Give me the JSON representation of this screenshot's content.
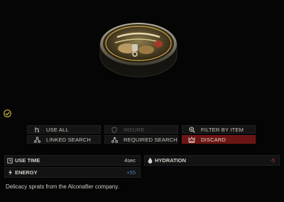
{
  "item": {
    "name": "Canned sprats",
    "label_text": "ШПРОТЫ В МАСЛЕ",
    "description": "Delicacy sprats from the Alconafter company."
  },
  "actions": [
    {
      "label": "USE ALL",
      "icon": "use-all-icon",
      "state": "normal"
    },
    {
      "label": "INSURE",
      "icon": "insure-shield-icon",
      "state": "disabled"
    },
    {
      "label": "FILTER BY ITEM",
      "icon": "magnifier-icon",
      "state": "normal"
    },
    {
      "label": "LINKED SEARCH",
      "icon": "link-search-icon",
      "state": "normal"
    },
    {
      "label": "REQUIRED SEARCH",
      "icon": "required-search-icon",
      "state": "normal"
    },
    {
      "label": "DISCARD",
      "icon": "crown-discard-icon",
      "state": "danger"
    }
  ],
  "stats": {
    "use_time": {
      "label": "USE TIME",
      "value": "4sec",
      "icon": "clock-icon"
    },
    "hydration": {
      "label": "HYDRATION",
      "value": "-5",
      "icon": "drop-icon",
      "value_color": "#b03a2e"
    },
    "energy": {
      "label": "ENERGY",
      "value": "+55",
      "icon": "lightning-icon",
      "value_color": "#4d7fc0"
    }
  },
  "colors": {
    "discard_bg": "#6b1414",
    "accent_yellow": "#c7b23a"
  }
}
